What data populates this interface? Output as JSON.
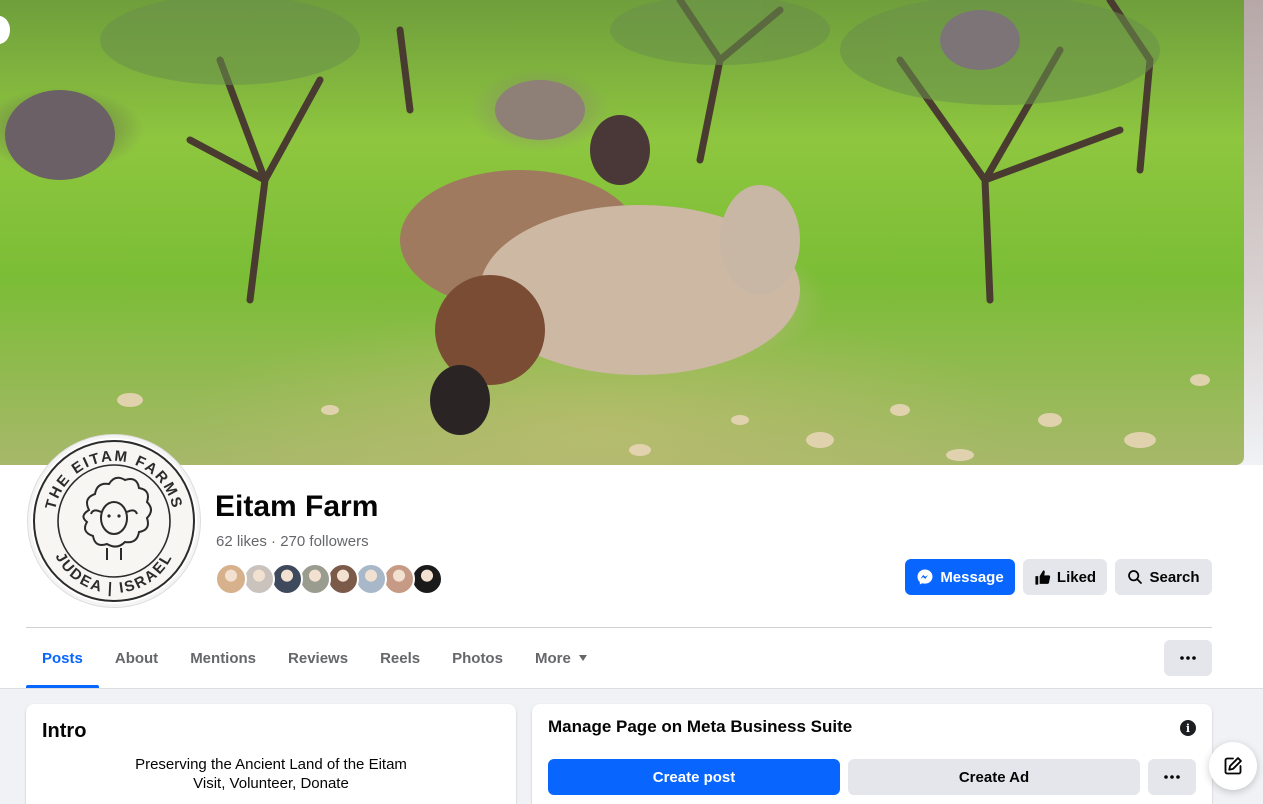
{
  "page": {
    "name": "Eitam Farm",
    "likes": "62 likes",
    "separator": "·",
    "followers": "270 followers"
  },
  "avatar": {
    "ring_top_text": "THE EITAM FARMS",
    "ring_bottom_text": "JUDEA | ISRAEL"
  },
  "actions": {
    "message_label": "Message",
    "liked_label": "Liked",
    "search_label": "Search",
    "more_icon": "ellipsis-icon"
  },
  "friends": {
    "avatar_colors": [
      "#d7b08c",
      "#c9c2bd",
      "#3e4a5c",
      "#9a9c90",
      "#7b5a4a",
      "#a8b8c8",
      "#c79a85",
      "#1a1a1a"
    ]
  },
  "tabs": [
    {
      "label": "Posts",
      "active": true
    },
    {
      "label": "About"
    },
    {
      "label": "Mentions"
    },
    {
      "label": "Reviews"
    },
    {
      "label": "Reels"
    },
    {
      "label": "Photos"
    },
    {
      "label": "More"
    }
  ],
  "intro": {
    "title": "Intro",
    "line1": "Preserving the Ancient Land of the Eitam",
    "line2": "Visit, Volunteer, Donate"
  },
  "business_suite": {
    "title": "Manage Page on Meta Business Suite",
    "info_icon": "info-icon",
    "create_post_label": "Create post",
    "create_ad_label": "Create Ad"
  },
  "colors": {
    "accent": "#0866ff",
    "button_grey": "#e4e6eb",
    "secondary_text": "#65676b"
  }
}
